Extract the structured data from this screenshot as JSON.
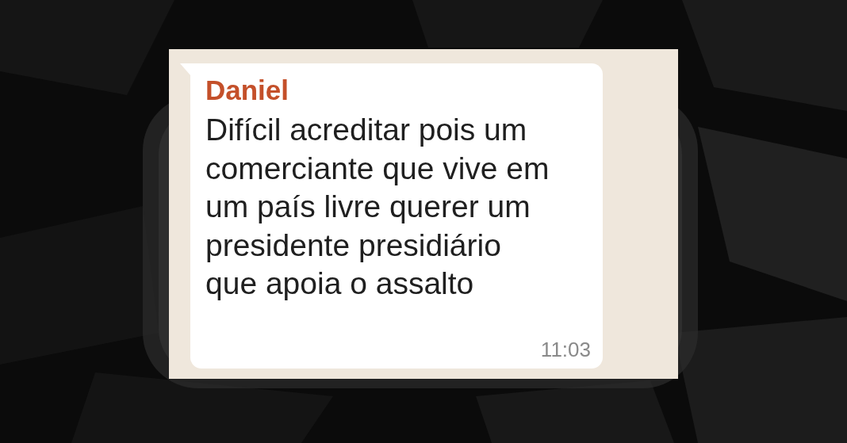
{
  "message": {
    "sender": "Daniel",
    "text": "Difícil acreditar pois um comerciante que vive em um país livre querer um presidente presidiário que apoia o assalto",
    "time": "11:03"
  }
}
